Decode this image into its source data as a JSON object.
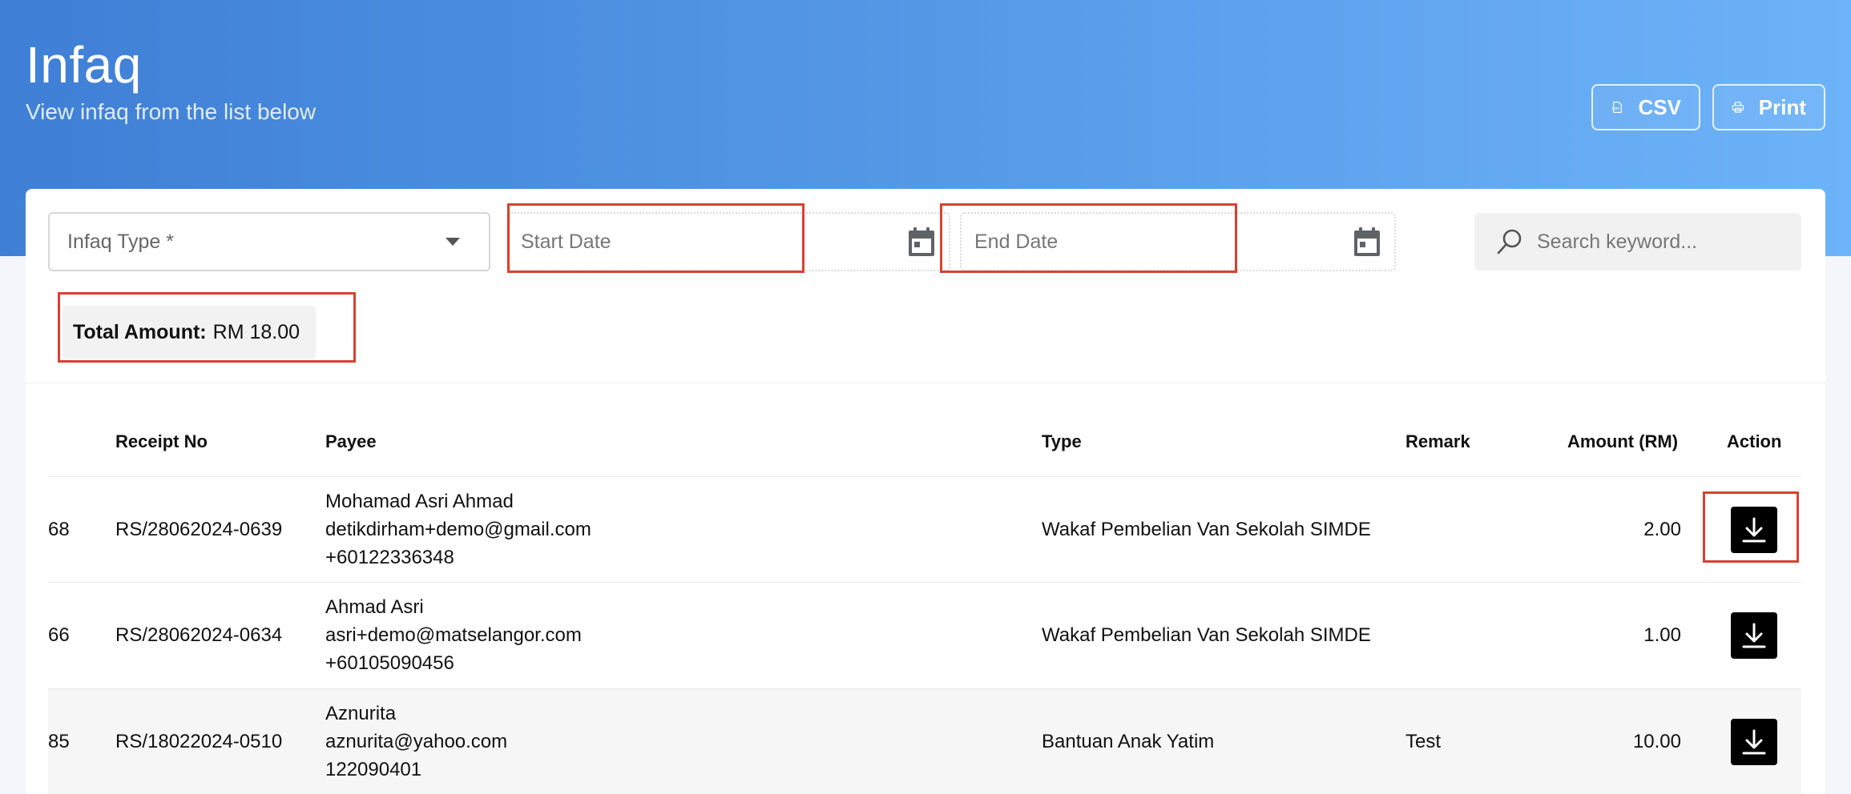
{
  "header": {
    "title": "Infaq",
    "subtitle": "View infaq from the list below",
    "csv_label": "CSV",
    "print_label": "Print"
  },
  "filters": {
    "infaq_type_placeholder": "Infaq Type *",
    "start_date_placeholder": "Start Date",
    "end_date_placeholder": "End Date",
    "search_placeholder": "Search keyword..."
  },
  "summary": {
    "total_label": "Total Amount:",
    "total_value": "RM 18.00"
  },
  "table": {
    "headers": {
      "receipt": "Receipt No",
      "payee": "Payee",
      "type": "Type",
      "remark": "Remark",
      "amount": "Amount (RM)",
      "action": "Action"
    },
    "rows": [
      {
        "id": "68",
        "receipt": "RS/28062024-0639",
        "payee_name": "Mohamad Asri Ahmad",
        "payee_email": "detikdirham+demo@gmail.com",
        "payee_phone": "+60122336348",
        "type": "Wakaf Pembelian Van Sekolah SIMDE",
        "remark": "",
        "amount": "2.00"
      },
      {
        "id": "66",
        "receipt": "RS/28062024-0634",
        "payee_name": "Ahmad Asri",
        "payee_email": "asri+demo@matselangor.com",
        "payee_phone": "+60105090456",
        "type": "Wakaf Pembelian Van Sekolah SIMDE",
        "remark": "",
        "amount": "1.00"
      },
      {
        "id": "85",
        "receipt": "RS/18022024-0510",
        "payee_name": "Aznurita",
        "payee_email": "aznurita@yahoo.com",
        "payee_phone": "122090401",
        "type": "Bantuan Anak Yatim",
        "remark": "Test",
        "amount": "10.00"
      }
    ]
  },
  "colors": {
    "header_gradient_start": "#3f7fd6",
    "header_gradient_end": "#6db3f9",
    "highlight": "#d9412f",
    "action_button": "#000000"
  },
  "icons": {
    "csv": "csv-file-icon",
    "print": "printer-icon",
    "date": "calendar-icon",
    "search": "search-icon",
    "download": "download-icon"
  }
}
